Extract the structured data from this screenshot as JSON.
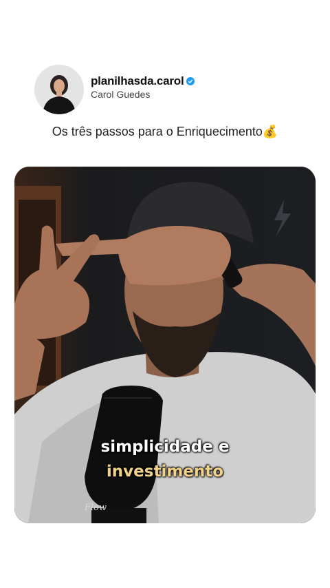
{
  "profile": {
    "handle": "planilhasda.carol",
    "display_name": "Carol Guedes",
    "verified": true,
    "verified_color": "#1d9bf0"
  },
  "post": {
    "caption": "Os três passos para o Enriquecimento",
    "caption_emoji": "💰"
  },
  "video": {
    "subtitle_line1": "simplicidade e",
    "subtitle_line2": "investimento",
    "subtitle_line2_color": "#f1d28a",
    "mic_brand": "Flow"
  }
}
